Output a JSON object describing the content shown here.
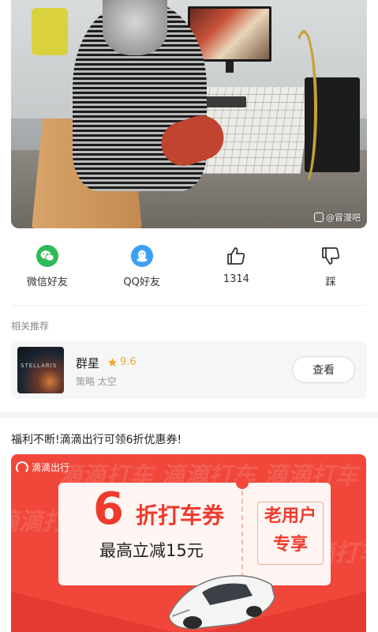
{
  "post": {
    "image_watermark": "@冒漫吧",
    "game_screen_title": "",
    "image_subject": ""
  },
  "actions": [
    {
      "label": "微信好友",
      "icon": "wechat-icon",
      "color": "#2dbb58"
    },
    {
      "label": "QQ好友",
      "icon": "qq-icon",
      "color": "#3aa0f5"
    },
    {
      "label": "1314",
      "icon": "thumbs-up-icon",
      "color": "#333333"
    },
    {
      "label": "踩",
      "icon": "thumbs-down-icon",
      "color": "#333333"
    }
  ],
  "related": {
    "section_title": "相关推荐",
    "game": {
      "name": "群星",
      "rating": "9.6",
      "tags": "策略 太空",
      "thumb_text": "STELLARIS",
      "button_label": "查看"
    }
  },
  "promo": {
    "title": "福利不断!滴滴出行可领6折优惠券!",
    "brand": "滴滴出行",
    "discount_number": "6",
    "coupon_name": "折打车券",
    "coupon_subtitle": "最高立减15元",
    "audience_line1": "老用户",
    "audience_line2": "专享",
    "background_words": "滴滴打车",
    "accent_color": "#f1473b"
  }
}
